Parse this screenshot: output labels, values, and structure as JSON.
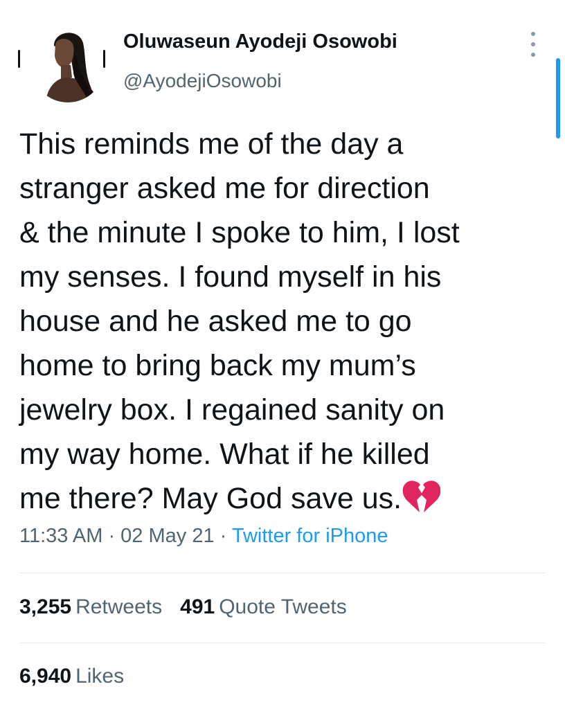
{
  "author": {
    "display_name": "Oluwaseun Ayodeji Osowobi",
    "handle": "@AyodejiOsowobi"
  },
  "tweet": {
    "lines": [
      "This reminds me of the day a",
      "stranger asked me for direction",
      "& the minute I spoke to him, I lost",
      "my senses. I found myself in his",
      "house and he asked me to go",
      "home to bring back my mum’s",
      "jewelry box. I regained sanity on",
      "my way home. What if he killed",
      "me there? May God save us."
    ],
    "emoji": "broken-heart-icon"
  },
  "meta": {
    "time": "11:33 AM",
    "separator": " · ",
    "date": "02 May 21",
    "source": "Twitter for iPhone"
  },
  "stats": {
    "retweets": {
      "count": "3,255",
      "label": "Retweets"
    },
    "quote_tweets": {
      "count": "491",
      "label": "Quote Tweets"
    },
    "likes": {
      "count": "6,940",
      "label": "Likes"
    }
  },
  "colors": {
    "accent": "#1d9bf0",
    "text_primary": "#0f1419",
    "text_secondary": "#536471",
    "divider": "#e6e9eb",
    "heart": "#e0245e"
  }
}
